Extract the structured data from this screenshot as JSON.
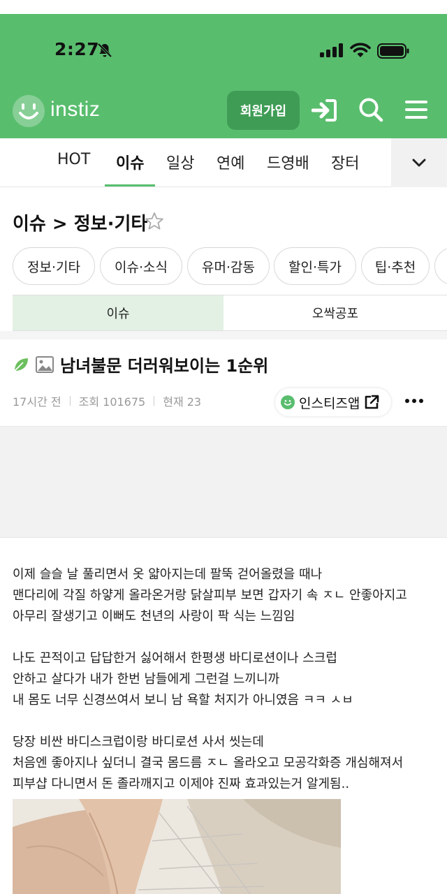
{
  "status_bar": {
    "time": "2:27"
  },
  "header": {
    "logo_text": "instiz",
    "join_label": "회원가입"
  },
  "categories": [
    {
      "label": "HOT"
    },
    {
      "label": "이슈"
    },
    {
      "label": "일상"
    },
    {
      "label": "연예"
    },
    {
      "label": "드영배"
    },
    {
      "label": "장터"
    }
  ],
  "board": {
    "title": "이슈 > 정보·기타",
    "chips": [
      "정보·기타",
      "이슈·소식",
      "유머·감동",
      "할인·특가",
      "팁·추천"
    ],
    "subtabs": [
      "이슈",
      "오싹공포"
    ]
  },
  "post": {
    "title": "남녀불문 더러워보이는 1순위",
    "time_ago": "17시간 전",
    "views": "조회 101675",
    "current": "현재 23",
    "app_label": "인스티즈앱",
    "paragraphs": [
      [
        "이제 슬슬 날 풀리면서 옷 얇아지는데 팔뚝 걷어올렸을 때나",
        "맨다리에 각질 하얗게 올라온거랑 닭살피부 보면 갑자기 속 ㅈㄴ 안좋아지고",
        "아무리 잘생기고 이뻐도 천년의 사랑이 팍 식는 느낌임"
      ],
      [
        "나도 끈적이고 답답한거 싫어해서 한평생 바디로션이나 스크럽",
        "안하고 살다가 내가 한번 남들에게 그런걸 느끼니까",
        "내 몸도 너무 신경쓰여서 보니 남 욕할 처지가 아니였음 ㅋㅋ ㅅㅂ"
      ],
      [
        "당장 비싼 바디스크럽이랑 바디로션 사서 씻는데",
        "처음엔 좋아지나 싶더니 결국 몸드름 ㅈㄴ 올라오고 모공각화증 개심해져서",
        "피부샵 다니면서 돈 졸라깨지고 이제야 진짜 효과있는거 알게됨.."
      ]
    ]
  },
  "colors": {
    "brand_green": "#59bd6e",
    "button_green": "#3f9c55",
    "active_subtab": "#e3f1e4"
  }
}
